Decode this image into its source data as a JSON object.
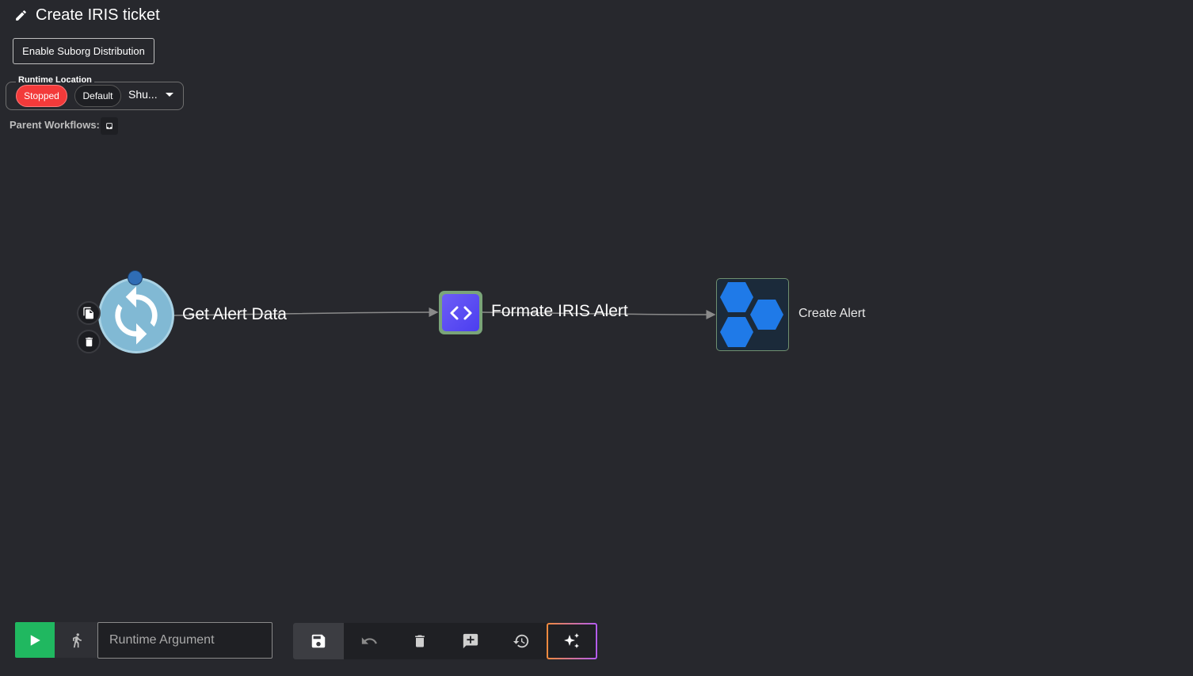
{
  "header": {
    "title": "Create IRIS ticket",
    "suborg_button": "Enable Suborg Distribution"
  },
  "runtime": {
    "label": "Runtime Location",
    "status": "Stopped",
    "environment": "Default",
    "selected": "Shu..."
  },
  "parent_workflows": {
    "label": "Parent Workflows:"
  },
  "workflow": {
    "nodes": [
      {
        "id": "trigger",
        "label": "Get Alert Data",
        "icon": "refresh-icon"
      },
      {
        "id": "code",
        "label": "Formate IRIS Alert",
        "icon": "code-brackets-icon"
      },
      {
        "id": "iris",
        "label": "Create Alert",
        "icon": "hexagons-icon"
      }
    ]
  },
  "toolbar": {
    "runtime_argument_placeholder": "Runtime Argument",
    "tools": [
      "save-icon",
      "undo-icon",
      "trash-icon",
      "add-comment-icon",
      "history-icon",
      "ai-sparkle-icon"
    ]
  },
  "colors": {
    "background": "#27282d",
    "run": "#20b860",
    "stopped": "#f33a3a"
  }
}
